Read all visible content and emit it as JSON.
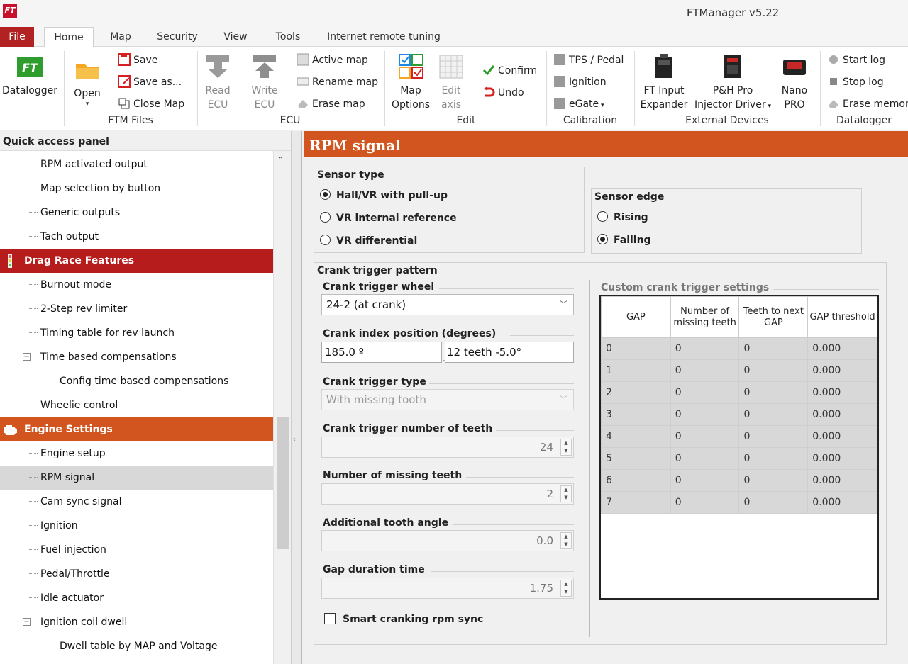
{
  "window": {
    "title": "FTManager v5.22",
    "logo_text": "FT"
  },
  "menu": {
    "tabs": [
      "File",
      "Home",
      "Map",
      "Security",
      "View",
      "Tools",
      "Internet remote tuning"
    ]
  },
  "ribbon": {
    "datalogger": "Datalogger",
    "open": "Open",
    "save": "Save",
    "save_as": "Save as...",
    "close_map": "Close Map",
    "ftm_files": "FTM Files",
    "read_ecu_1": "Read",
    "read_ecu_2": "ECU",
    "write_ecu_1": "Write",
    "write_ecu_2": "ECU",
    "active_map": "Active map",
    "rename_map": "Rename map",
    "erase_map": "Erase map",
    "ecu": "ECU",
    "map_options_1": "Map",
    "map_options_2": "Options",
    "edit_axis_1": "Edit",
    "edit_axis_2": "axis",
    "confirm": "Confirm",
    "undo": "Undo",
    "edit": "Edit",
    "tps_pedal": "TPS / Pedal",
    "ignition": "Ignition",
    "egate": "eGate",
    "calibration": "Calibration",
    "ft_input_1": "FT Input",
    "ft_input_2": "Expander",
    "ph_pro_1": "P&H Pro",
    "ph_pro_2": "Injector Driver",
    "nano_1": "Nano",
    "nano_2": "PRO",
    "external_devices": "External Devices",
    "start_log": "Start log",
    "stop_log": "Stop log",
    "erase_memory": "Erase memor",
    "datalogger_group": "Datalogger"
  },
  "sidebar": {
    "header": "Quick access panel",
    "items": [
      {
        "label": "RPM activated output"
      },
      {
        "label": "Map selection by button"
      },
      {
        "label": "Generic outputs"
      },
      {
        "label": "Tach output"
      },
      {
        "label": "Drag Race Features"
      },
      {
        "label": "Burnout mode"
      },
      {
        "label": "2-Step rev limiter"
      },
      {
        "label": "Timing table for rev launch"
      },
      {
        "label": "Time based compensations"
      },
      {
        "label": "Config time based compensations"
      },
      {
        "label": "Wheelie control"
      },
      {
        "label": "Engine Settings"
      },
      {
        "label": "Engine setup"
      },
      {
        "label": "RPM signal"
      },
      {
        "label": "Cam sync signal"
      },
      {
        "label": "Ignition"
      },
      {
        "label": "Fuel injection"
      },
      {
        "label": "Pedal/Throttle"
      },
      {
        "label": "Idle actuator"
      },
      {
        "label": "Ignition coil dwell"
      },
      {
        "label": "Dwell table by MAP and Voltage"
      }
    ]
  },
  "page": {
    "title": "RPM signal",
    "sensor_type": {
      "title": "Sensor type",
      "options": [
        "Hall/VR with pull-up",
        "VR internal reference",
        "VR differential"
      ],
      "selected": "Hall/VR with pull-up"
    },
    "sensor_edge": {
      "title": "Sensor edge",
      "options": [
        "Rising",
        "Falling"
      ],
      "selected": "Falling"
    },
    "crank": {
      "title": "Crank trigger pattern",
      "wheel_label": "Crank trigger wheel",
      "wheel_value": "24-2 (at crank)",
      "index_label": "Crank index position (degrees)",
      "index_value": "185.0 º",
      "index_info": "12 teeth -5.0°",
      "type_label": "Crank trigger type",
      "type_value": "With missing tooth",
      "teeth_label": "Crank trigger number of teeth",
      "teeth_value": "24",
      "missing_label": "Number of missing teeth",
      "missing_value": "2",
      "additional_label": "Additional tooth angle",
      "additional_value": "0.0",
      "gap_label": "Gap duration time",
      "gap_value": "1.75",
      "smart_label": "Smart cranking rpm sync"
    },
    "custom": {
      "title": "Custom crank trigger settings",
      "columns": [
        "GAP",
        "Number of missing teeth",
        "Teeth to next GAP",
        "GAP threshold"
      ],
      "rows": [
        [
          "0",
          "0",
          "0",
          "0.000"
        ],
        [
          "1",
          "0",
          "0",
          "0.000"
        ],
        [
          "2",
          "0",
          "0",
          "0.000"
        ],
        [
          "3",
          "0",
          "0",
          "0.000"
        ],
        [
          "4",
          "0",
          "0",
          "0.000"
        ],
        [
          "5",
          "0",
          "0",
          "0.000"
        ],
        [
          "6",
          "0",
          "0",
          "0.000"
        ],
        [
          "7",
          "0",
          "0",
          "0.000"
        ]
      ]
    }
  },
  "colors": {
    "accent": "#d2541e",
    "drag_race": "#b71c1c",
    "engine": "#d2541e",
    "file_tab": "#b22222"
  }
}
